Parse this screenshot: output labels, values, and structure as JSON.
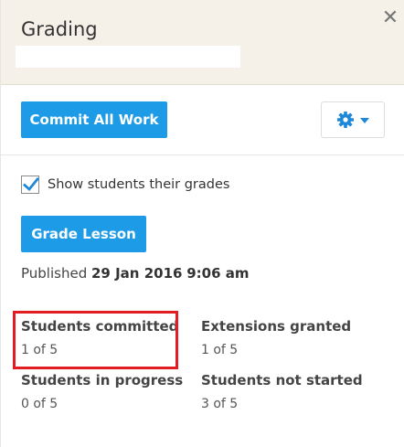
{
  "header": {
    "title": "Grading",
    "close_glyph": "✕"
  },
  "toolbar": {
    "commit_label": "Commit All Work",
    "settings_icon": "gear-icon",
    "settings_caret_icon": "caret-down-icon"
  },
  "options": {
    "show_grades_label": "Show students their grades",
    "show_grades_checked": true
  },
  "grade_button_label": "Grade Lesson",
  "published": {
    "prefix": "Published",
    "date": "29 Jan 2016",
    "time": "9:06 am"
  },
  "stats": [
    {
      "label": "Students committed",
      "value": "1 of 5"
    },
    {
      "label": "Extensions granted",
      "value": "1 of 5"
    },
    {
      "label": "Students in progress",
      "value": "0 of 5"
    },
    {
      "label": "Students not started",
      "value": "3 of 5"
    }
  ],
  "colors": {
    "primary_button": "#1e9be6",
    "header_bg": "#f6f1e8",
    "highlight_border": "#e31b23"
  }
}
